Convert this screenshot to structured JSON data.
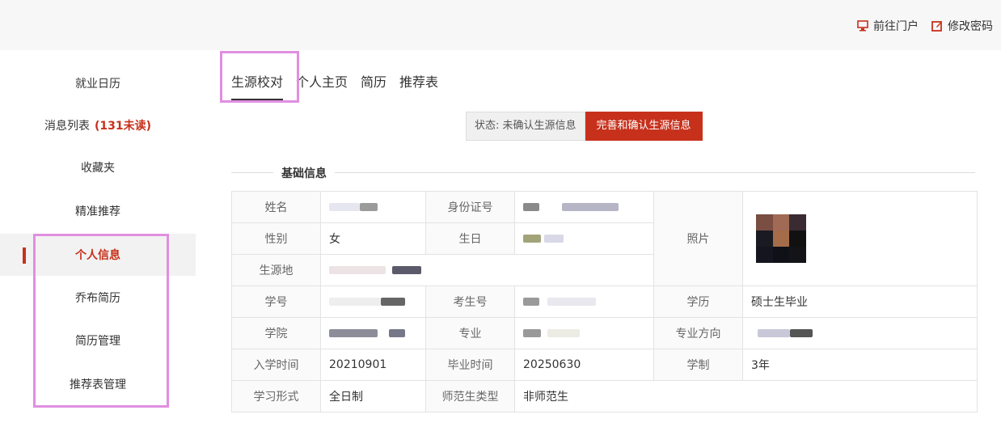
{
  "header": {
    "portal_label": "前往门户",
    "password_label": "修改密码"
  },
  "sidebar": {
    "items": [
      {
        "label": "就业日历"
      },
      {
        "label": "消息列表",
        "badge": "(131未读)"
      },
      {
        "label": "收藏夹"
      },
      {
        "label": "精准推荐"
      },
      {
        "label": "个人信息",
        "active": true
      },
      {
        "label": "乔布简历"
      },
      {
        "label": "简历管理"
      },
      {
        "label": "推荐表管理"
      }
    ]
  },
  "tabs": [
    {
      "label": "生源校对",
      "active": true
    },
    {
      "label": "个人主页"
    },
    {
      "label": "简历"
    },
    {
      "label": "推荐表"
    }
  ],
  "status": {
    "text": "状态: 未确认生源信息",
    "confirm_label": "完善和确认生源信息"
  },
  "section": {
    "title": "基础信息"
  },
  "table": {
    "name_label": "姓名",
    "id_label": "身份证号",
    "photo_label": "照片",
    "gender_label": "性别",
    "gender_value": "女",
    "birthday_label": "生日",
    "origin_label": "生源地",
    "student_no_label": "学号",
    "exam_no_label": "考生号",
    "education_label": "学历",
    "education_value": "硕士生毕业",
    "college_label": "学院",
    "major_label": "专业",
    "direction_label": "专业方向",
    "enroll_label": "入学时间",
    "enroll_value": "20210901",
    "grad_label": "毕业时间",
    "grad_value": "20250630",
    "length_label": "学制",
    "length_value": "3年",
    "study_form_label": "学习形式",
    "study_form_value": "全日制",
    "normal_label": "师范生类型",
    "normal_value": "非师范生"
  },
  "colors": {
    "accent": "#c7311c",
    "highlight": "#e08fe0"
  }
}
